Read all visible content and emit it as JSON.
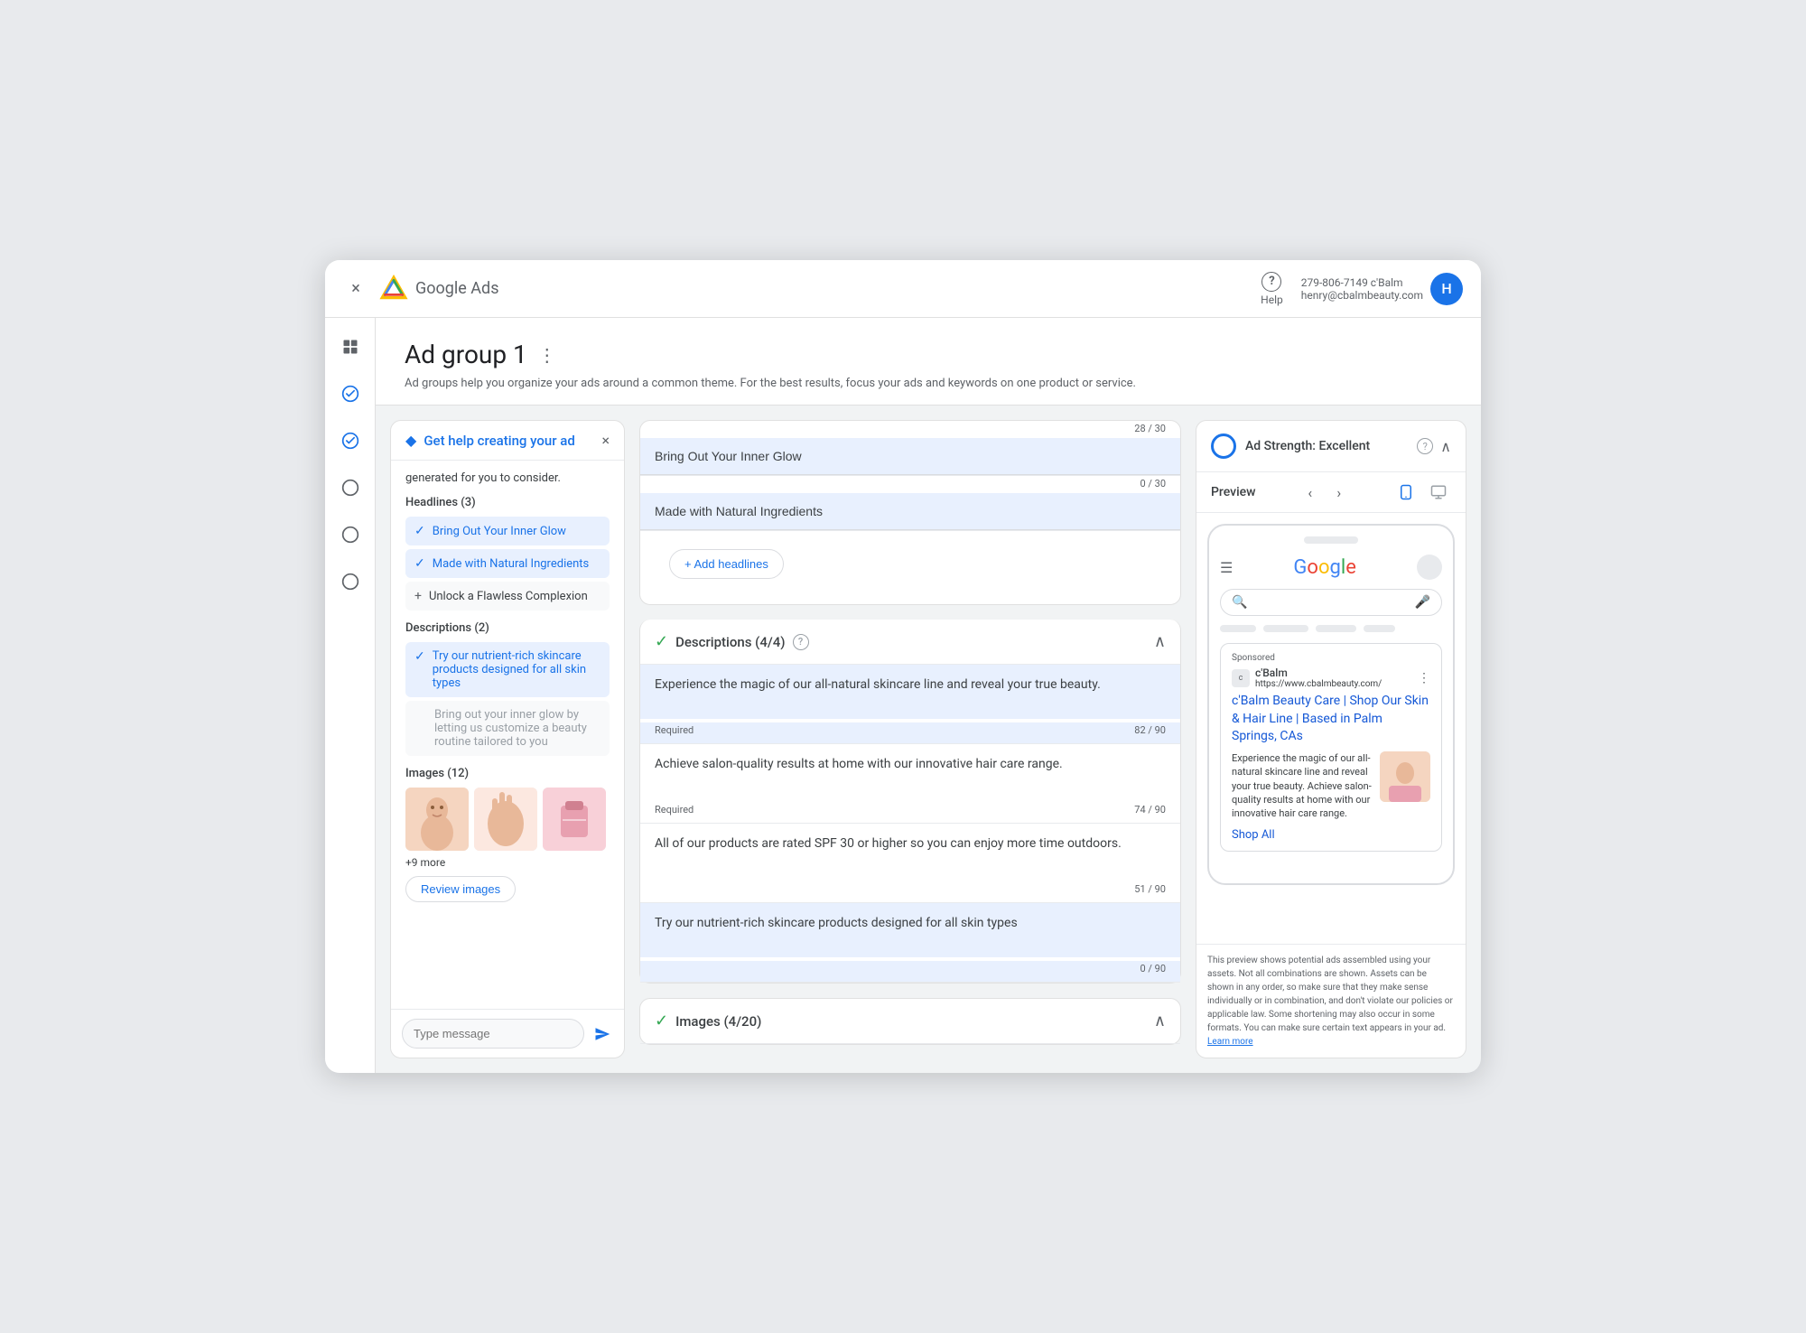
{
  "topbar": {
    "close_label": "×",
    "brand": "Google",
    "product": "Ads",
    "help_label": "Help",
    "help_icon": "?",
    "account_phone": "279-806-7149 c'Balm",
    "account_email": "henry@cbalmbeauty.com",
    "account_initial": "H"
  },
  "sidebar": {
    "icons": [
      "⊞",
      "✓",
      "✓",
      "○",
      "○",
      "○"
    ]
  },
  "page": {
    "title": "Ad group 1",
    "menu_dots": "⋮",
    "description": "Ad groups help you organize your ads around a common theme. For the best results, focus your ads and keywords on one product or service."
  },
  "ai_panel": {
    "title": "Get help creating your ad",
    "close": "×",
    "generated_text": "generated for you to consider.",
    "headlines_label": "Headlines (3)",
    "headlines": [
      {
        "text": "Bring Out Your Inner Glow",
        "checked": true
      },
      {
        "text": "Made with Natural Ingredients",
        "checked": true
      },
      {
        "text": "Unlock a Flawless Complexion",
        "checked": false
      }
    ],
    "descriptions_label": "Descriptions (2)",
    "descriptions": [
      {
        "text": "Try our nutrient-rich skincare products designed for all skin types",
        "checked": true
      },
      {
        "text": "Bring out your inner glow by letting us customize a beauty routine tailored to you",
        "checked": false,
        "muted": true
      }
    ],
    "images_label": "Images (12)",
    "images_more": "+9 more",
    "review_images_btn": "Review images",
    "message_placeholder": "Type message"
  },
  "middle": {
    "headlines_counter_1": "28 / 30",
    "headline_1": "Bring Out Your Inner Glow",
    "headline_2_counter": "0 / 30",
    "headline_2": "Made with Natural Ingredients",
    "add_headlines_btn": "+ Add headlines",
    "descriptions_section": {
      "label": "Descriptions (4/4)",
      "items": [
        {
          "text": "Experience the magic of our all-natural skincare line and reveal your true beauty.",
          "required": "Required",
          "counter": "82 / 90",
          "highlight": true
        },
        {
          "text": "Achieve salon-quality results at home with our innovative hair care range.",
          "required": "Required",
          "counter": "74 / 90",
          "highlight": false
        },
        {
          "text": "All of our products are rated SPF 30 or higher so you can enjoy more time outdoors.",
          "required": "",
          "counter": "51 / 90",
          "highlight": false
        },
        {
          "text": "Try our nutrient-rich skincare products designed for all skin types",
          "required": "",
          "counter": "0 / 90",
          "highlight": true
        }
      ]
    },
    "images_section": {
      "label": "Images (4/20)"
    }
  },
  "right_panel": {
    "ad_strength_label": "Ad Strength: Excellent",
    "preview_label": "Preview",
    "sponsored": "Sponsored",
    "brand_name": "c'Balm",
    "brand_url": "https://www.cbalmbeauty.com/",
    "ad_headline": "c'Balm Beauty Care | Shop Our Skin & Hair Line | Based in Palm Springs, CAs",
    "ad_desc": "Experience the magic of our all-natural skincare line and reveal your true beauty. Achieve salon-quality results at home with our innovative hair care range.",
    "shop_all": "Shop All",
    "disclaimer": "This preview shows potential ads assembled using your assets. Not all combinations are shown. Assets can be shown in any order, so make sure that they make sense individually or in combination, and don't violate our policies or applicable law. Some shortening may also occur in some formats. You can make sure certain text appears in your ad.",
    "learn_more": "Learn more"
  }
}
